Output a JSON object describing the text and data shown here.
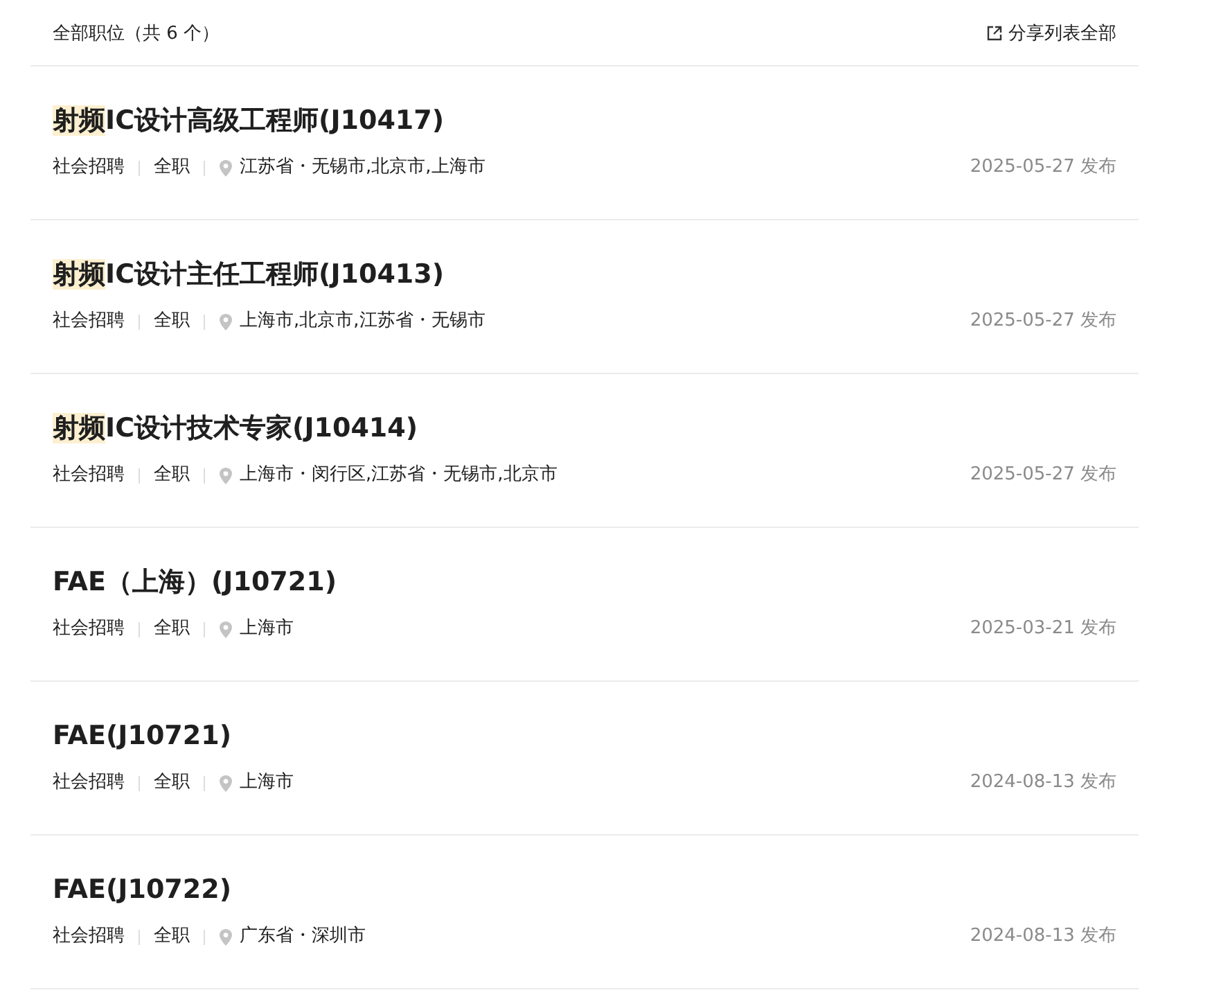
{
  "header": {
    "title": "全部职位（共 6 个）",
    "share_link": "分享列表全部"
  },
  "jobs": [
    {
      "title_parts": [
        {
          "text": "射频",
          "highlighted": true
        },
        {
          "text": "IC设计高级工程师(J10417)",
          "highlighted": false
        }
      ],
      "type": "社会招聘",
      "schedule": "全职",
      "location": "江苏省・无锡市,北京市,上海市",
      "date": "2025-05-27 发布"
    },
    {
      "title_parts": [
        {
          "text": "射频",
          "highlighted": true
        },
        {
          "text": "IC设计主任工程师(J10413)",
          "highlighted": false
        }
      ],
      "type": "社会招聘",
      "schedule": "全职",
      "location": "上海市,北京市,江苏省・无锡市",
      "date": "2025-05-27 发布"
    },
    {
      "title_parts": [
        {
          "text": "射频",
          "highlighted": true
        },
        {
          "text": "IC设计技术专家(J10414)",
          "highlighted": false
        }
      ],
      "type": "社会招聘",
      "schedule": "全职",
      "location": "上海市・闵行区,江苏省・无锡市,北京市",
      "date": "2025-05-27 发布"
    },
    {
      "title_parts": [
        {
          "text": "FAE（上海）(J10721)",
          "highlighted": false
        }
      ],
      "type": "社会招聘",
      "schedule": "全职",
      "location": "上海市",
      "date": "2025-03-21 发布"
    },
    {
      "title_parts": [
        {
          "text": "FAE(J10721)",
          "highlighted": false
        }
      ],
      "type": "社会招聘",
      "schedule": "全职",
      "location": "上海市",
      "date": "2024-08-13 发布"
    },
    {
      "title_parts": [
        {
          "text": "FAE(J10722)",
          "highlighted": false
        }
      ],
      "type": "社会招聘",
      "schedule": "全职",
      "location": "广东省・深圳市",
      "date": "2024-08-13 发布"
    }
  ]
}
